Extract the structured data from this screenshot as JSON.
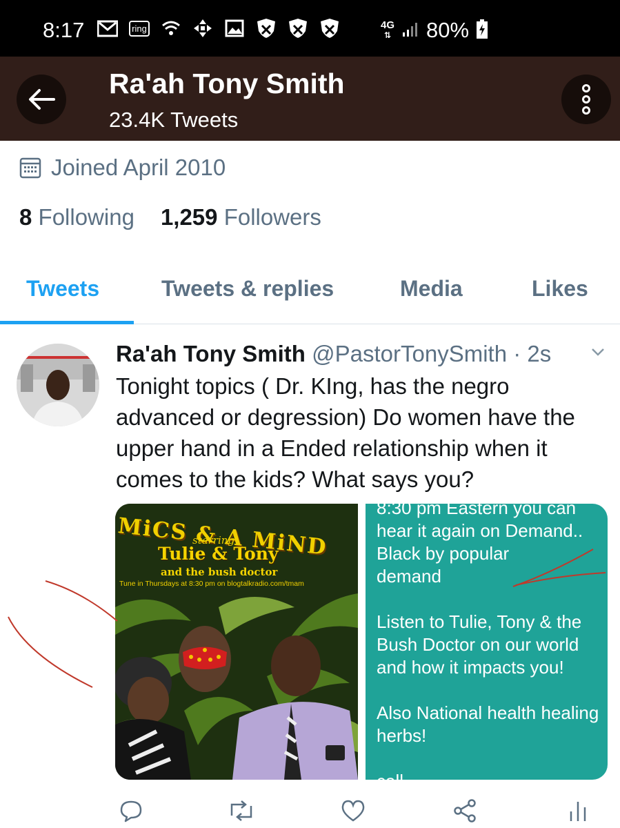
{
  "status_bar": {
    "time": "8:17",
    "ring_label": "ring",
    "network_label": "4G",
    "battery": "80%"
  },
  "header": {
    "name": "Ra'ah Tony Smith",
    "tweet_count": "23.4K Tweets"
  },
  "profile": {
    "joined": "Joined April 2010",
    "following_count": "8",
    "following_label": "Following",
    "followers_count": "1,259",
    "followers_label": "Followers"
  },
  "tabs": [
    {
      "label": "Tweets",
      "active": true
    },
    {
      "label": "Tweets & replies",
      "active": false
    },
    {
      "label": "Media",
      "active": false
    },
    {
      "label": "Likes",
      "active": false
    }
  ],
  "tweet": {
    "author": "Ra'ah Tony Smith",
    "handle": "@PastorTonySmith",
    "time": "· 2s",
    "text": "Tonight topics ( Dr. KIng, has the negro advanced or degression)  Do women have the upper hand in a Ended  relationship when it comes to the kids? What says you?",
    "poster": {
      "title": "MiCS & A MiND",
      "starring": "starring",
      "names": "Tulie & Tony",
      "subtitle": "and the bush doctor",
      "tune_in": "Tune in Thursdays at 8:30 pm on blogtalkradio.com/tmam"
    },
    "right_image_text": "8:30 pm Eastern you can\nhear it again on Demand..\nBlack  by popular\ndemand\n\nListen to Tulie, Tony & the Bush Doctor on our world and how it impacts you!\n\nAlso National health healing herbs!\n\ncall"
  },
  "colors": {
    "header_bg": "#311e19",
    "accent": "#1da1f2",
    "secondary_text": "#5b7083"
  }
}
